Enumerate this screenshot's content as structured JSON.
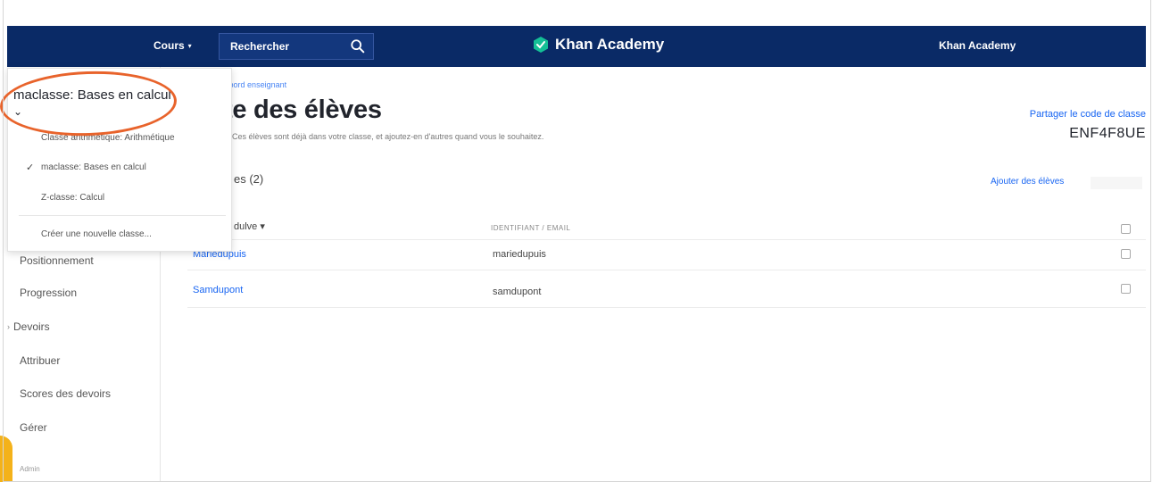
{
  "nav": {
    "courses_label": "Cours",
    "search_label": "Rechercher",
    "brand_name": "Khan Academy",
    "account_label": "Khan Academy"
  },
  "breadcrumb": "Tableau de bord enseignant",
  "page_title": "Liste des élèves",
  "intro_text": "Ces élèves sont déjà dans votre classe, et ajoutez-en d'autres quand vous le souhaitez.",
  "share": {
    "link_label": "Partager le code de classe",
    "class_code": "ENF4F8UE"
  },
  "students": {
    "count_label": "es (2)",
    "add_label": "Ajouter des élèves",
    "columns": {
      "name": "dulve ▾",
      "id": "IDENTIFIANT / EMAIL"
    },
    "rows": [
      {
        "name": "Mariedupuis",
        "id": "mariedupuis"
      },
      {
        "name": "Samdupont",
        "id": "samdupont"
      }
    ]
  },
  "class_dropdown": {
    "current": "maclasse: Bases en calcul",
    "items": [
      {
        "label": "Classe arithmétique: Arithmétique",
        "selected": false
      },
      {
        "label": "maclasse: Bases en calcul",
        "selected": true
      },
      {
        "label": "Z-classe: Calcul",
        "selected": false
      }
    ],
    "create_label": "Créer une nouvelle classe..."
  },
  "sidebar": {
    "items": [
      {
        "label": "Positionnement"
      },
      {
        "label": "Progression"
      }
    ],
    "section_devoirs": "Devoirs",
    "devoirs_items": [
      {
        "label": "Attribuer"
      },
      {
        "label": "Scores des devoirs"
      },
      {
        "label": "Gérer"
      }
    ],
    "section_bottom": "Admin"
  },
  "colors": {
    "nav_bg": "#0a2a66",
    "link_blue": "#1865f2",
    "highlight_orange": "#e8632b",
    "accent_yellow": "#f4b21a"
  }
}
